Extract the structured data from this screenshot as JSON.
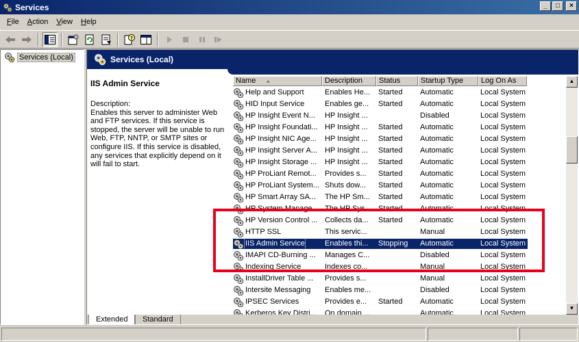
{
  "window": {
    "title": "Services"
  },
  "menu": [
    {
      "label": "File",
      "key": "F",
      "rest": "ile"
    },
    {
      "label": "Action",
      "key": "A",
      "rest": "ction"
    },
    {
      "label": "View",
      "key": "V",
      "rest": "iew"
    },
    {
      "label": "Help",
      "key": "H",
      "rest": "elp"
    }
  ],
  "tree": {
    "root_label": "Services (Local)"
  },
  "main": {
    "header_title": "Services (Local)",
    "selected_service_title": "IIS Admin Service",
    "description_label": "Description:",
    "description_text": "Enables this server to administer Web and FTP services. If this service is stopped, the server will be unable to run Web, FTP, NNTP, or SMTP sites or configure IIS. If this service is disabled, any services that explicitly depend on it will fail to start."
  },
  "columns": [
    "Name",
    "Description",
    "Status",
    "Startup Type",
    "Log On As"
  ],
  "services": [
    {
      "name": "Help and Support",
      "desc": "Enables He...",
      "status": "Started",
      "startup": "Automatic",
      "logon": "Local System"
    },
    {
      "name": "HID Input Service",
      "desc": "Enables ge...",
      "status": "Started",
      "startup": "Automatic",
      "logon": "Local System"
    },
    {
      "name": "HP Insight Event N...",
      "desc": "HP Insight ...",
      "status": "",
      "startup": "Disabled",
      "logon": "Local System"
    },
    {
      "name": "HP Insight Foundati...",
      "desc": "HP Insight ...",
      "status": "Started",
      "startup": "Automatic",
      "logon": "Local System"
    },
    {
      "name": "HP Insight NIC Age...",
      "desc": "HP Insight ...",
      "status": "Started",
      "startup": "Automatic",
      "logon": "Local System"
    },
    {
      "name": "HP Insight Server A...",
      "desc": "HP Insight ...",
      "status": "Started",
      "startup": "Automatic",
      "logon": "Local System"
    },
    {
      "name": "HP Insight Storage ...",
      "desc": "HP Insight ...",
      "status": "Started",
      "startup": "Automatic",
      "logon": "Local System"
    },
    {
      "name": "HP ProLiant Remot...",
      "desc": "Provides s...",
      "status": "Started",
      "startup": "Automatic",
      "logon": "Local System"
    },
    {
      "name": "HP ProLiant System...",
      "desc": "Shuts dow...",
      "status": "Started",
      "startup": "Automatic",
      "logon": "Local System"
    },
    {
      "name": "HP Smart Array SA...",
      "desc": "The HP Sm...",
      "status": "Started",
      "startup": "Automatic",
      "logon": "Local System"
    },
    {
      "name": "HP System Manage...",
      "desc": "The HP Sys...",
      "status": "Started",
      "startup": "Automatic",
      "logon": "Local System"
    },
    {
      "name": "HP Version Control ...",
      "desc": "Collects da...",
      "status": "Started",
      "startup": "Automatic",
      "logon": "Local System"
    },
    {
      "name": "HTTP SSL",
      "desc": "This servic...",
      "status": "",
      "startup": "Manual",
      "logon": "Local System"
    },
    {
      "name": "IIS Admin Service",
      "desc": "Enables thi...",
      "status": "Stopping",
      "startup": "Automatic",
      "logon": "Local System",
      "selected": true
    },
    {
      "name": "IMAPI CD-Burning ...",
      "desc": "Manages C...",
      "status": "",
      "startup": "Disabled",
      "logon": "Local System"
    },
    {
      "name": "Indexing Service",
      "desc": "Indexes co...",
      "status": "",
      "startup": "Manual",
      "logon": "Local System"
    },
    {
      "name": "InstallDriver Table ...",
      "desc": "Provides s...",
      "status": "",
      "startup": "Manual",
      "logon": "Local System"
    },
    {
      "name": "Intersite Messaging",
      "desc": "Enables me...",
      "status": "",
      "startup": "Disabled",
      "logon": "Local System"
    },
    {
      "name": "IPSEC Services",
      "desc": "Provides e...",
      "status": "Started",
      "startup": "Automatic",
      "logon": "Local System"
    },
    {
      "name": "Kerberos Key Distri...",
      "desc": "On domain ...",
      "status": "",
      "startup": "Automatic",
      "logon": "Local System"
    }
  ],
  "tabs": [
    {
      "label": "Extended",
      "active": true
    },
    {
      "label": "Standard",
      "active": false
    }
  ],
  "colors": {
    "title_blue": "#0a246a",
    "highlight_red": "#e8001c",
    "face": "#d4d0c8"
  }
}
